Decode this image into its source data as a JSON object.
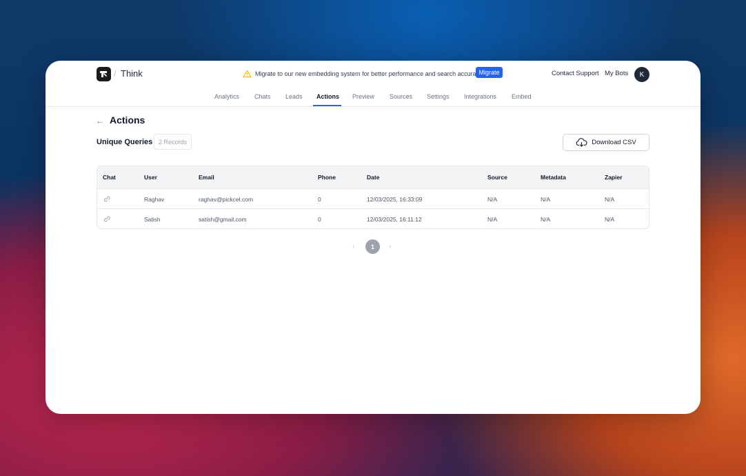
{
  "header": {
    "brand": "Think",
    "separator": "/",
    "notice_text": "Migrate to our new embedding system for better performance and search accuracy.",
    "migrate_label": "Migrate",
    "contact_label": "Contact Support",
    "mybots_label": "My Bots",
    "avatar_initial": "K"
  },
  "tabs": [
    "Analytics",
    "Chats",
    "Leads",
    "Actions",
    "Preview",
    "Sources",
    "Settings",
    "Integrations",
    "Embed"
  ],
  "active_tab": "Actions",
  "page": {
    "back_icon": "arrow-left-icon",
    "title": "Actions",
    "subtitle": "Unique Queries",
    "records": "2 Records",
    "download_label": "Download CSV"
  },
  "table": {
    "columns": [
      "Chat",
      "User",
      "Email",
      "Phone",
      "Date",
      "Source",
      "Metadata",
      "Zapier"
    ],
    "rows": [
      [
        "",
        "Raghav",
        "raghav@pickcel.com",
        "0",
        "12/03/2025, 16:33:09",
        "N/A",
        "N/A",
        "N/A"
      ],
      [
        "",
        "Satish",
        "satish@gmail.com",
        "0",
        "12/03/2025, 16:11:12",
        "N/A",
        "N/A",
        "N/A"
      ]
    ]
  },
  "pagination": {
    "prev": "‹",
    "current": "1",
    "next": "›"
  },
  "colors": {
    "accent": "#2563eb",
    "avatar": "#1f2937",
    "warning": "#eab308"
  }
}
